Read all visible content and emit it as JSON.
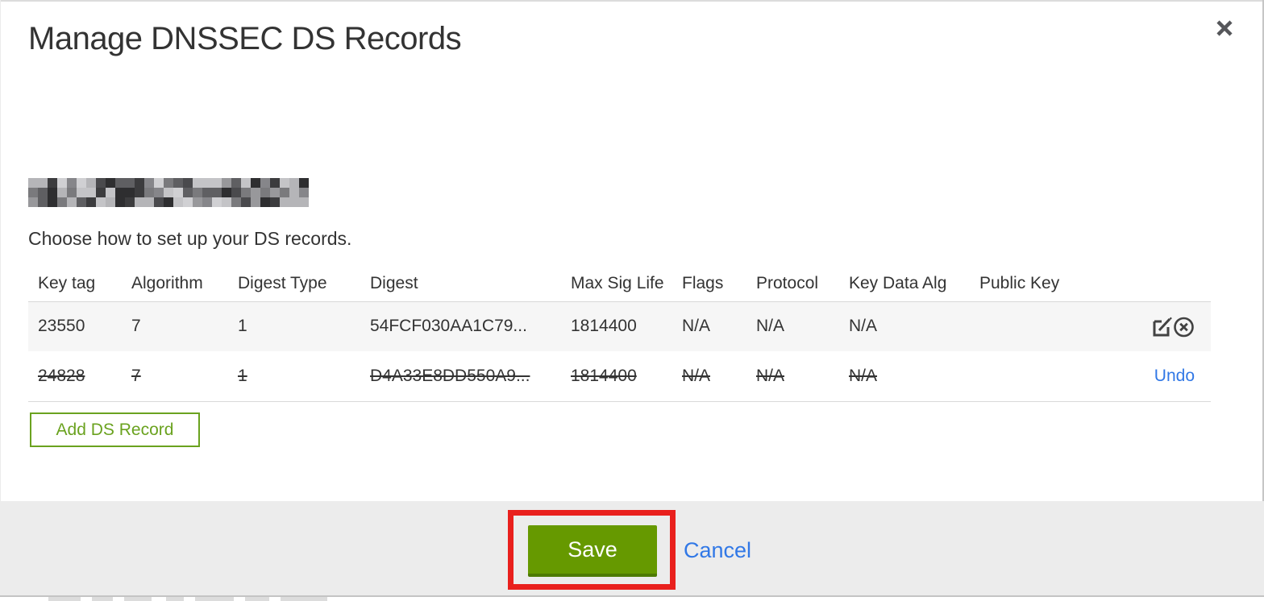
{
  "modal": {
    "title": "Manage DNSSEC DS Records",
    "instruction": "Choose how to set up your DS records.",
    "domain": {
      "redacted": true
    },
    "table": {
      "columns": [
        "Key tag",
        "Algorithm",
        "Digest Type",
        "Digest",
        "Max Sig Life",
        "Flags",
        "Protocol",
        "Key Data Alg",
        "Public Key"
      ],
      "rows": [
        {
          "key_tag": "23550",
          "algorithm": "7",
          "digest_type": "1",
          "digest": "54FCF030AA1C79...",
          "max_sig_life": "1814400",
          "flags": "N/A",
          "protocol": "N/A",
          "key_data_alg": "N/A",
          "public_key": "",
          "status": "active",
          "actions": [
            "edit",
            "delete"
          ]
        },
        {
          "key_tag": "24828",
          "algorithm": "7",
          "digest_type": "1",
          "digest": "D4A33E8DD550A9...",
          "max_sig_life": "1814400",
          "flags": "N/A",
          "protocol": "N/A",
          "key_data_alg": "N/A",
          "public_key": "",
          "status": "marked-for-deletion",
          "actions": [
            "undo"
          ],
          "undo_label": "Undo"
        }
      ]
    },
    "add_button_label": "Add DS Record",
    "footer": {
      "save_label": "Save",
      "cancel_label": "Cancel"
    }
  },
  "annotation": {
    "type": "red-rectangle",
    "target": "save-button",
    "color": "#e9201d"
  },
  "colors": {
    "green_button": "#669900",
    "green_button_shadow": "#4d7a02",
    "green_outline": "#6aa21f",
    "link_blue": "#3178e6",
    "row_alt_bg": "#f6f6f6",
    "footer_bg": "#ececec",
    "text": "#333333",
    "icon": "#474747"
  },
  "redaction": {
    "palette": [
      "#2e2e30",
      "#4a4a4d",
      "#5f5f62",
      "#7a7a7d",
      "#98989b",
      "#b5b5b8",
      "#d0d0d3",
      "#86868a",
      "#c4c4c7",
      "#3c3c3e"
    ]
  }
}
